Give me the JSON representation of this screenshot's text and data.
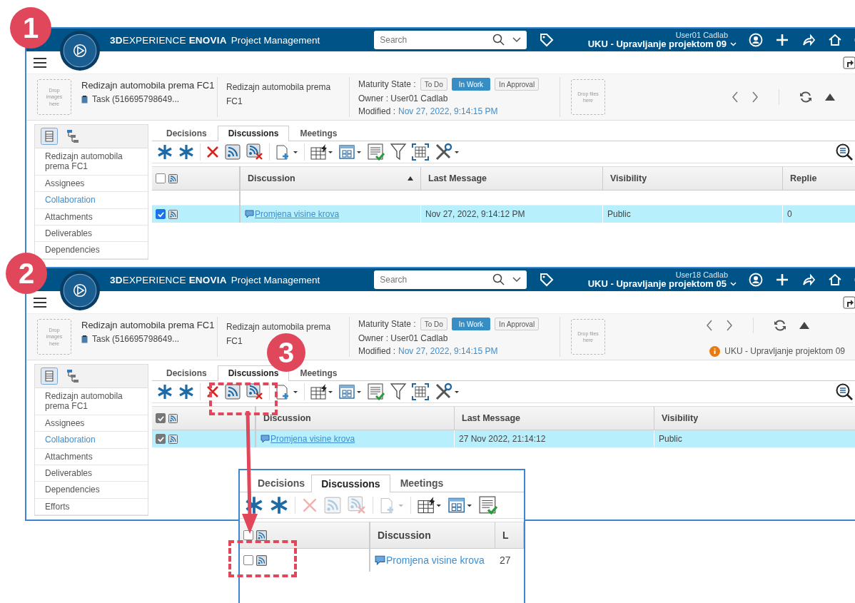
{
  "screens": [
    {
      "brand": "**3D**EXPERIENCE **ENOVIA**",
      "app": "Project Management",
      "search": {
        "placeholder": "Search"
      },
      "user": "User01 Cadlab",
      "workspace": "UKU - Upravljanje projektom 09",
      "drop_images": "Drop images here",
      "object_title": "Redizajn automobila prema FC1",
      "object_type": "Task (516695798649...",
      "description": "Redizajn automobila prema FC1",
      "maturity_label": "Maturity State :",
      "states": [
        {
          "label": "To Do",
          "selected": false
        },
        {
          "label": "In Work",
          "selected": true
        },
        {
          "label": "In Approval",
          "selected": false
        }
      ],
      "owner": "Owner : User01 Cadlab",
      "modified_label": "Modified :",
      "modified": "Nov 27, 2022, 9:14:15 PM",
      "drop_files": "Drop files here",
      "sidebar": [
        {
          "label": "Redizajn automobila prema FC1",
          "selected": false
        },
        {
          "label": "Assignees",
          "selected": false
        },
        {
          "label": "Collaboration",
          "selected": true
        },
        {
          "label": "Attachments",
          "selected": false
        },
        {
          "label": "Deliverables",
          "selected": false
        },
        {
          "label": "Dependencies",
          "selected": false
        }
      ],
      "tabs": [
        {
          "label": "Decisions",
          "selected": false
        },
        {
          "label": "Discussions",
          "selected": true
        },
        {
          "label": "Meetings",
          "selected": false
        }
      ],
      "all_checked": false,
      "columns": [
        {
          "label": "Discussion",
          "sorted": true
        },
        {
          "label": "Last Message",
          "sorted": false
        },
        {
          "label": "Visibility",
          "sorted": false
        },
        {
          "label": "Replie",
          "sorted": false
        }
      ],
      "rows": [
        {
          "checked": true,
          "selected": true,
          "cells": [
            "Promjena visine krova",
            "Nov 27, 2022, 9:14:12 PM",
            "Public",
            "0"
          ]
        }
      ]
    },
    {
      "brand": "**3D**EXPERIENCE **ENOVIA**",
      "app": "Project Management",
      "search": {
        "placeholder": "Search"
      },
      "user": "User18 Cadlab",
      "workspace": "UKU - Upravljanje projektom 05",
      "drop_images": "Drop images here",
      "object_title": "Redizajn automobila prema FC1",
      "object_type": "Task (516695798649...",
      "description": "Redizajn automobila prema FC1",
      "maturity_label": "Maturity State :",
      "states": [
        {
          "label": "To Do",
          "selected": false
        },
        {
          "label": "In Work",
          "selected": true
        },
        {
          "label": "In Approval",
          "selected": false
        }
      ],
      "owner": "Owner : User01 Cadlab",
      "modified_label": "Modified :",
      "modified": "Nov 27, 2022, 9:14:15 PM",
      "drop_files": "Drop files here",
      "notice": "UKU - Upravljanje projektom 09",
      "sidebar": [
        {
          "label": "Redizajn automobila prema FC1",
          "selected": false
        },
        {
          "label": "Assignees",
          "selected": false
        },
        {
          "label": "Collaboration",
          "selected": true
        },
        {
          "label": "Attachments",
          "selected": false
        },
        {
          "label": "Deliverables",
          "selected": false
        },
        {
          "label": "Dependencies",
          "selected": false
        },
        {
          "label": "Efforts",
          "selected": false
        }
      ],
      "tabs": [
        {
          "label": "Decisions",
          "selected": false
        },
        {
          "label": "Discussions",
          "selected": true
        },
        {
          "label": "Meetings",
          "selected": false
        }
      ],
      "all_checked": true,
      "columns": [
        {
          "label": "Discussion",
          "sorted": false
        },
        {
          "label": "Last Message",
          "sorted": false
        },
        {
          "label": "Visibility",
          "sorted": false
        }
      ],
      "rows": [
        {
          "checked": true,
          "selected": true,
          "cells": [
            "Promjena visine krova",
            "27 Nov 2022, 21:14:12",
            "Public"
          ]
        }
      ]
    }
  ],
  "inset": {
    "tabs": [
      {
        "label": "Decisions",
        "selected": false
      },
      {
        "label": "Discussions",
        "selected": true
      },
      {
        "label": "Meetings",
        "selected": false
      }
    ],
    "actions_disabled": true,
    "all_checked": false,
    "columns": [
      {
        "label": "Discussion",
        "sorted": false
      },
      {
        "label": "L",
        "sorted": false
      }
    ],
    "rows": [
      {
        "checked": false,
        "selected": false,
        "cells": [
          "Promjena visine krova",
          "27"
        ]
      }
    ]
  },
  "callouts": [
    {
      "number": "1"
    },
    {
      "number": "2"
    },
    {
      "number": "3"
    }
  ]
}
